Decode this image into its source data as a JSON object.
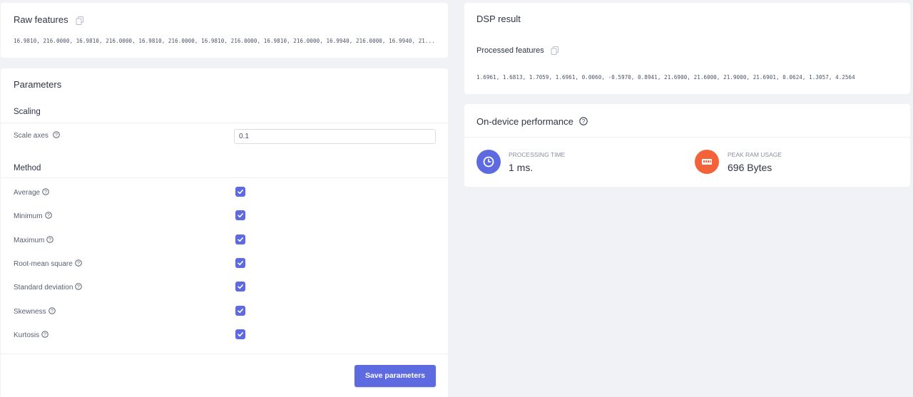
{
  "raw_features": {
    "title": "Raw features",
    "values": "16.9810, 216.0000, 16.9810, 216.0000, 16.9810, 216.0000, 16.9810, 216.0000, 16.9810, 216.0000, 16.9940, 216.0000, 16.9940, 21..."
  },
  "parameters": {
    "title": "Parameters",
    "scaling": {
      "label": "Scaling",
      "scale_axes_label": "Scale axes",
      "scale_axes_value": "0.1"
    },
    "method": {
      "label": "Method",
      "options": [
        {
          "label": "Average",
          "checked": true
        },
        {
          "label": "Minimum",
          "checked": true
        },
        {
          "label": "Maximum",
          "checked": true
        },
        {
          "label": "Root-mean square",
          "checked": true
        },
        {
          "label": "Standard deviation",
          "checked": true
        },
        {
          "label": "Skewness",
          "checked": true
        },
        {
          "label": "Kurtosis",
          "checked": true
        }
      ]
    },
    "save_label": "Save parameters"
  },
  "dsp_result": {
    "title": "DSP result",
    "processed_label": "Processed features",
    "processed_values": "1.6961, 1.6813, 1.7059, 1.6961, 0.0060, -0.5970, 0.8941, 21.6900, 21.6000, 21.9000, 21.6901, 0.0624, 1.3057, 4.2564"
  },
  "performance": {
    "title": "On-device performance",
    "processing_time_label": "PROCESSING TIME",
    "processing_time_value": "1 ms.",
    "peak_ram_label": "PEAK RAM USAGE",
    "peak_ram_value": "696 Bytes"
  },
  "colors": {
    "accent": "#5d6ae0",
    "ram_icon": "#f4623a",
    "background": "#f1f2f6"
  }
}
